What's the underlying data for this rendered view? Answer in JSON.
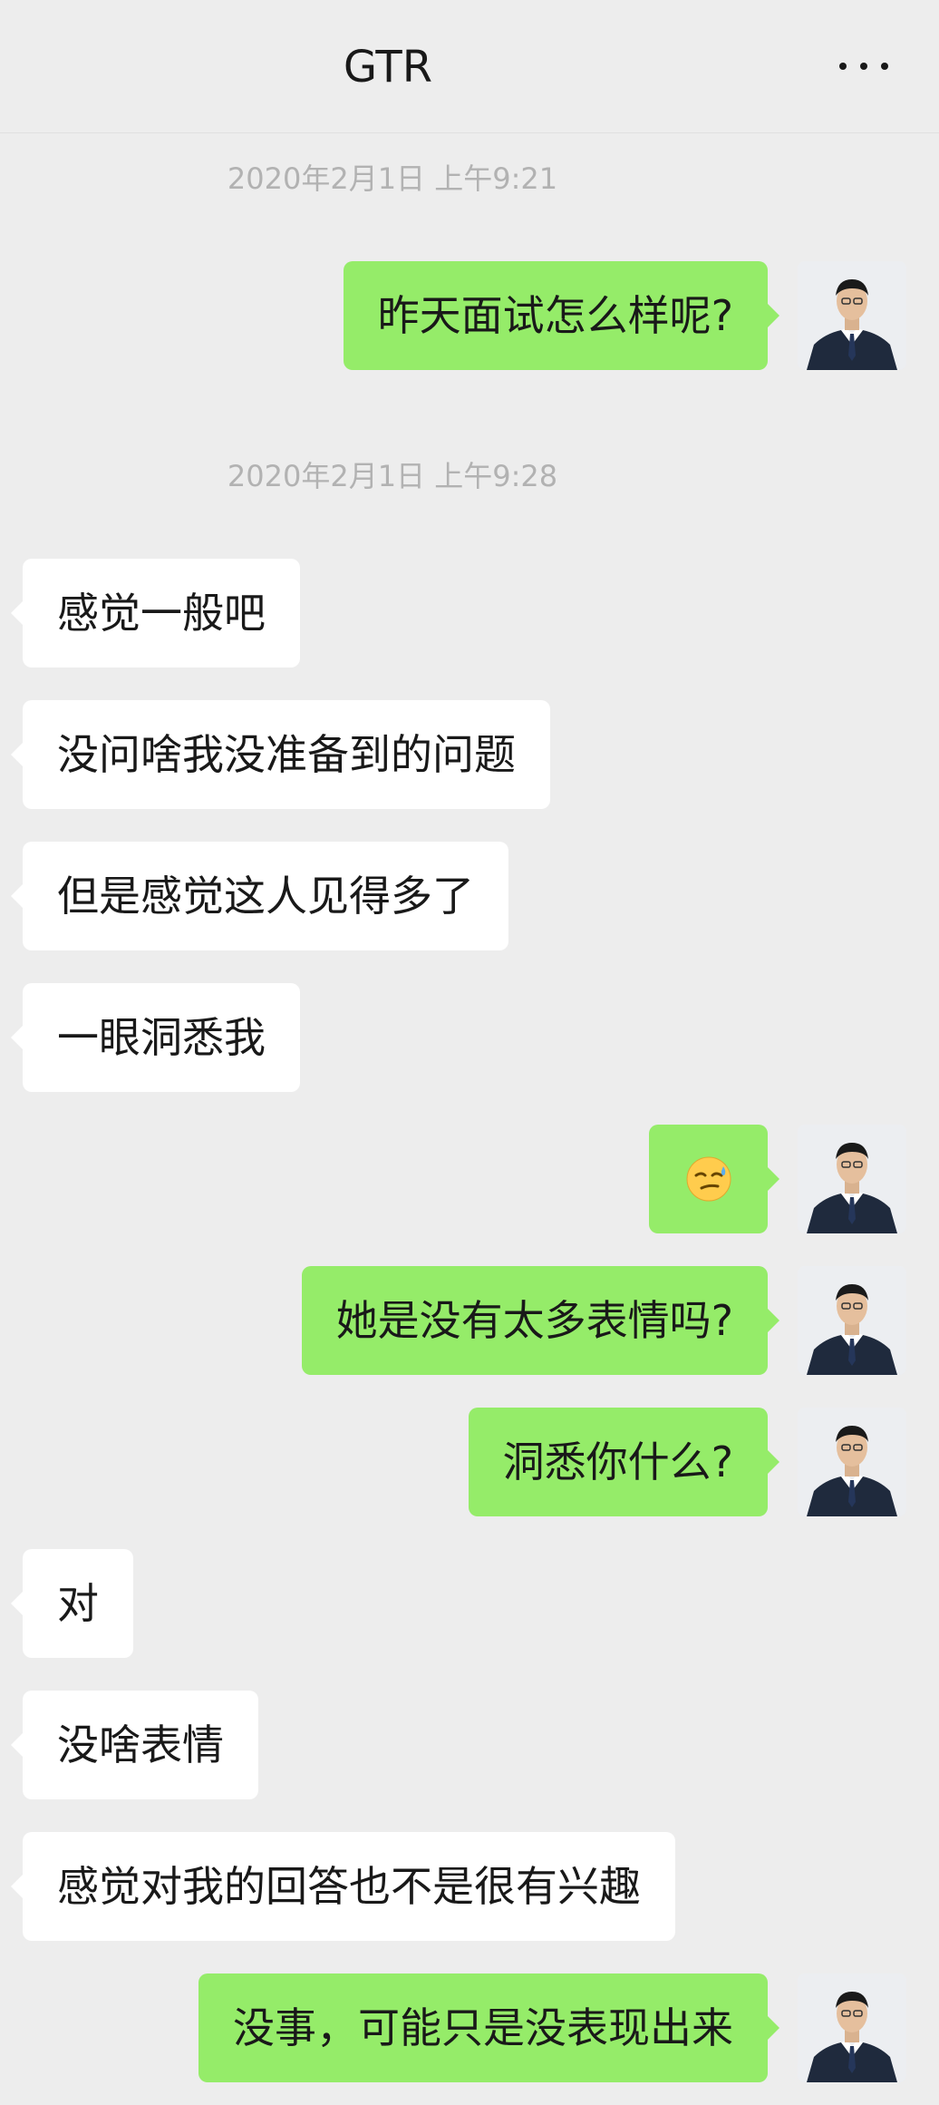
{
  "header": {
    "title": "GTR",
    "more_icon": "more-dots-icon"
  },
  "timestamps": [
    "2020年2月1日 上午9:21",
    "2020年2月1日 上午9:28"
  ],
  "messages": [
    {
      "side": "me",
      "text": "昨天面试怎么样呢?"
    },
    {
      "side": "them",
      "text": "感觉一般吧"
    },
    {
      "side": "them",
      "text": "没问啥我没准备到的问题"
    },
    {
      "side": "them",
      "text": "但是感觉这人见得多了"
    },
    {
      "side": "them",
      "text": "一眼洞悉我"
    },
    {
      "side": "me",
      "emoji": "smirk-sweat-emoji"
    },
    {
      "side": "me",
      "text": "她是没有太多表情吗?"
    },
    {
      "side": "me",
      "text": "洞悉你什么?"
    },
    {
      "side": "them",
      "text": "对"
    },
    {
      "side": "them",
      "text": "没啥表情"
    },
    {
      "side": "them",
      "text": "感觉对我的回答也不是很有兴趣"
    },
    {
      "side": "me",
      "text": "没事，可能只是没表现出来"
    }
  ],
  "colors": {
    "background": "#ededed",
    "my_bubble": "#95ec69",
    "their_bubble": "#ffffff",
    "timestamp": "#b2b2b2"
  }
}
